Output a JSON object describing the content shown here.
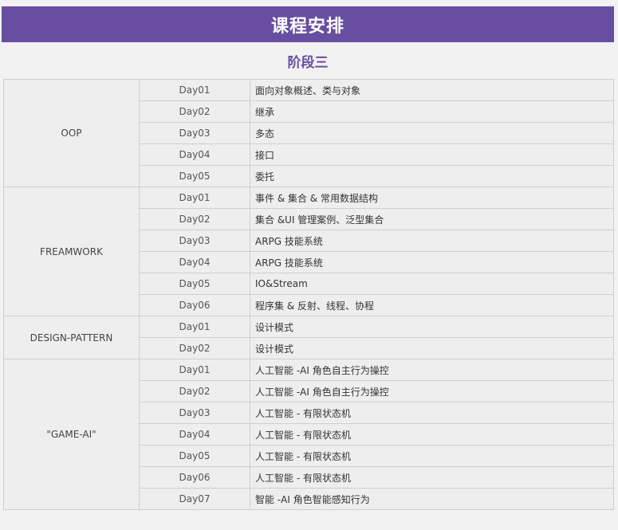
{
  "header": {
    "title": "课程安排",
    "stage": "阶段三"
  },
  "colors": {
    "accent": "#674ea0",
    "background": "#f2f2f2",
    "cell": "#eeeeee",
    "border": "#cfcfcf"
  },
  "schedule": [
    {
      "topic": "OOP",
      "rows": [
        {
          "day": "Day01",
          "content": "面向对象概述、类与对象"
        },
        {
          "day": "Day02",
          "content": "继承"
        },
        {
          "day": "Day03",
          "content": "多态"
        },
        {
          "day": "Day04",
          "content": "接口"
        },
        {
          "day": "Day05",
          "content": "委托"
        }
      ]
    },
    {
      "topic": "FREAMWORK",
      "rows": [
        {
          "day": "Day01",
          "content": "事件 & 集合 & 常用数据结构"
        },
        {
          "day": "Day02",
          "content": "集合 &UI 管理案例、泛型集合"
        },
        {
          "day": "Day03",
          "content": "ARPG 技能系统"
        },
        {
          "day": "Day04",
          "content": "ARPG 技能系统"
        },
        {
          "day": "Day05",
          "content": "IO&Stream"
        },
        {
          "day": "Day06",
          "content": "程序集 & 反射、线程、协程"
        }
      ]
    },
    {
      "topic": "DESIGN-PATTERN",
      "rows": [
        {
          "day": "Day01",
          "content": "设计模式"
        },
        {
          "day": "Day02",
          "content": "设计模式"
        }
      ]
    },
    {
      "topic": "\"GAME-AI\"",
      "rows": [
        {
          "day": "Day01",
          "content": "人工智能 -AI 角色自主行为操控"
        },
        {
          "day": "Day02",
          "content": "人工智能 -AI 角色自主行为操控"
        },
        {
          "day": "Day03",
          "content": "人工智能 - 有限状态机"
        },
        {
          "day": "Day04",
          "content": "人工智能 - 有限状态机"
        },
        {
          "day": "Day05",
          "content": "人工智能 - 有限状态机"
        },
        {
          "day": "Day06",
          "content": "人工智能 - 有限状态机"
        },
        {
          "day": "Day07",
          "content": "智能 -AI 角色智能感知行为"
        }
      ]
    }
  ]
}
